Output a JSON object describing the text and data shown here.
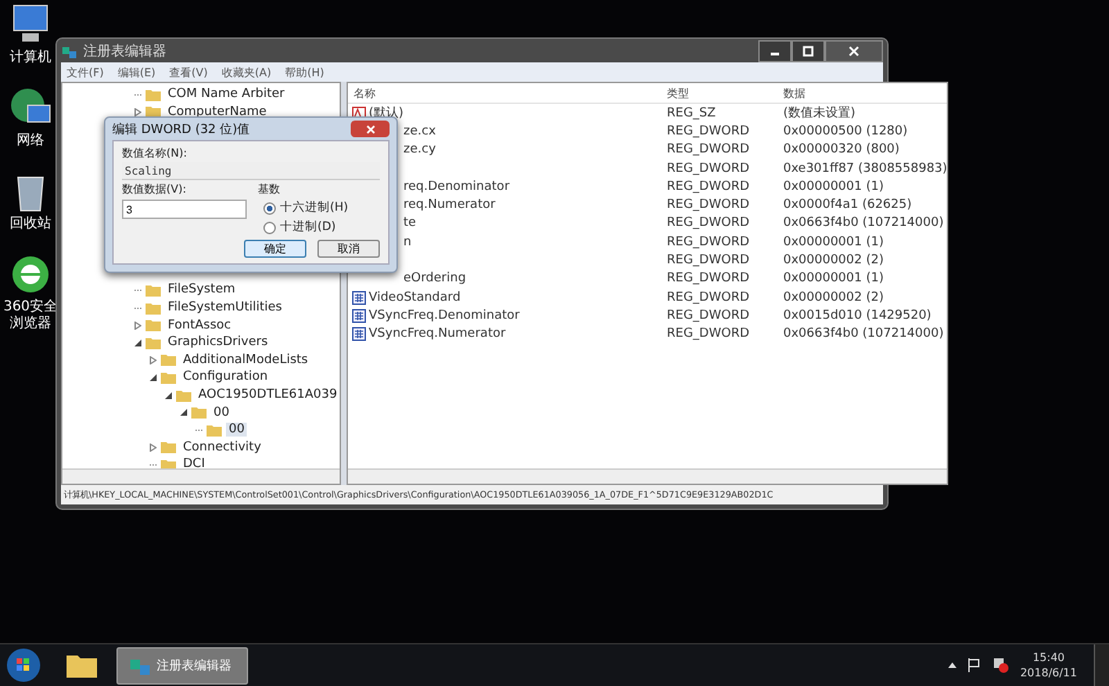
{
  "desktop_icons": [
    {
      "label": "计算机",
      "kind": "computer"
    },
    {
      "label": "网络",
      "kind": "network"
    },
    {
      "label": "回收站",
      "kind": "recycle"
    },
    {
      "label": "360安全浏览器",
      "kind": "browser"
    }
  ],
  "window": {
    "title": "注册表编辑器",
    "menu": [
      "文件(F)",
      "编辑(E)",
      "查看(V)",
      "收藏夹(A)",
      "帮助(H)"
    ],
    "tree": {
      "before": [
        {
          "label": "COM Name Arbiter",
          "kind": "leaf",
          "selected": false
        },
        {
          "label": "ComputerName",
          "kind": "branch",
          "expanded": false,
          "selected": false
        }
      ],
      "after": [
        {
          "label": "FileSystem",
          "kind": "leaf",
          "selected": false
        },
        {
          "label": "FileSystemUtilities",
          "kind": "leaf",
          "selected": false
        },
        {
          "label": "FontAssoc",
          "kind": "branch",
          "expanded": false,
          "selected": false
        },
        {
          "label": "GraphicsDrivers",
          "kind": "branch",
          "expanded": true,
          "selected": false,
          "children": [
            {
              "label": "AdditionalModeLists",
              "kind": "branch",
              "expanded": false,
              "selected": false
            },
            {
              "label": "Configuration",
              "kind": "branch",
              "expanded": true,
              "selected": false,
              "children": [
                {
                  "label": "AOC1950DTLE61A039",
                  "kind": "branch",
                  "expanded": true,
                  "selected": false,
                  "children": [
                    {
                      "label": "00",
                      "kind": "branch",
                      "expanded": true,
                      "selected": false,
                      "children": [
                        {
                          "label": "00",
                          "kind": "leaf",
                          "selected": true
                        }
                      ]
                    }
                  ]
                }
              ]
            },
            {
              "label": "Connectivity",
              "kind": "branch",
              "expanded": false,
              "selected": false
            },
            {
              "label": "DCI",
              "kind": "leaf",
              "selected": false
            }
          ]
        }
      ]
    },
    "columns": [
      "名称",
      "类型",
      "数据"
    ],
    "rows": [
      {
        "kind": "string",
        "name": "(默认)",
        "type": "REG_SZ",
        "data": "(数值未设置)"
      },
      {
        "kind": "covered",
        "name": "ze.cx",
        "type": "REG_DWORD",
        "data": "0x00000500 (1280)"
      },
      {
        "kind": "covered",
        "name": "ze.cy",
        "type": "REG_DWORD",
        "data": "0x00000320 (800)"
      },
      {
        "kind": "covered",
        "type": "REG_DWORD",
        "data": "0xe301ff87 (3808558983)"
      },
      {
        "kind": "covered",
        "name": "req.Denominator",
        "type": "REG_DWORD",
        "data": "0x00000001 (1)"
      },
      {
        "kind": "covered",
        "name": "req.Numerator",
        "type": "REG_DWORD",
        "data": "0x0000f4a1 (62625)"
      },
      {
        "kind": "covered",
        "name": "te",
        "type": "REG_DWORD",
        "data": "0x0663f4b0 (107214000)"
      },
      {
        "kind": "covered",
        "name": "n",
        "type": "REG_DWORD",
        "data": "0x00000001 (1)"
      },
      {
        "kind": "covered",
        "type": "REG_DWORD",
        "data": "0x00000002 (2)"
      },
      {
        "kind": "covered",
        "name": "eOrdering",
        "type": "REG_DWORD",
        "data": "0x00000001 (1)"
      },
      {
        "kind": "binary",
        "name": "VideoStandard",
        "type": "REG_DWORD",
        "data": "0x00000002 (2)"
      },
      {
        "kind": "binary",
        "name": "VSyncFreq.Denominator",
        "type": "REG_DWORD",
        "data": "0x0015d010 (1429520)"
      },
      {
        "kind": "binary",
        "name": "VSyncFreq.Numerator",
        "type": "REG_DWORD",
        "data": "0x0663f4b0 (107214000)"
      }
    ],
    "status_bar": "计算机\\HKEY_LOCAL_MACHINE\\SYSTEM\\ControlSet001\\Control\\GraphicsDrivers\\Configuration\\AOC1950DTLE61A039056_1A_07DE_F1^5D71C9E9E3129AB02D1C"
  },
  "dialog": {
    "title": "编辑 DWORD (32 位)值",
    "name_label": "数值名称(N):",
    "name_value": "Scaling",
    "data_label": "数值数据(V):",
    "data_value": "3",
    "base_label": "基数",
    "bases": [
      {
        "label": "十六进制(H)",
        "selected": true
      },
      {
        "label": "十进制(D)",
        "selected": false
      }
    ],
    "buttons": [
      {
        "label": "确定",
        "default": true
      },
      {
        "label": "取消",
        "default": false
      }
    ]
  },
  "taskbar": {
    "tasks": [
      {
        "label": "注册表编辑器",
        "active": true
      }
    ],
    "time": "15:40",
    "date": "2018/6/11"
  }
}
